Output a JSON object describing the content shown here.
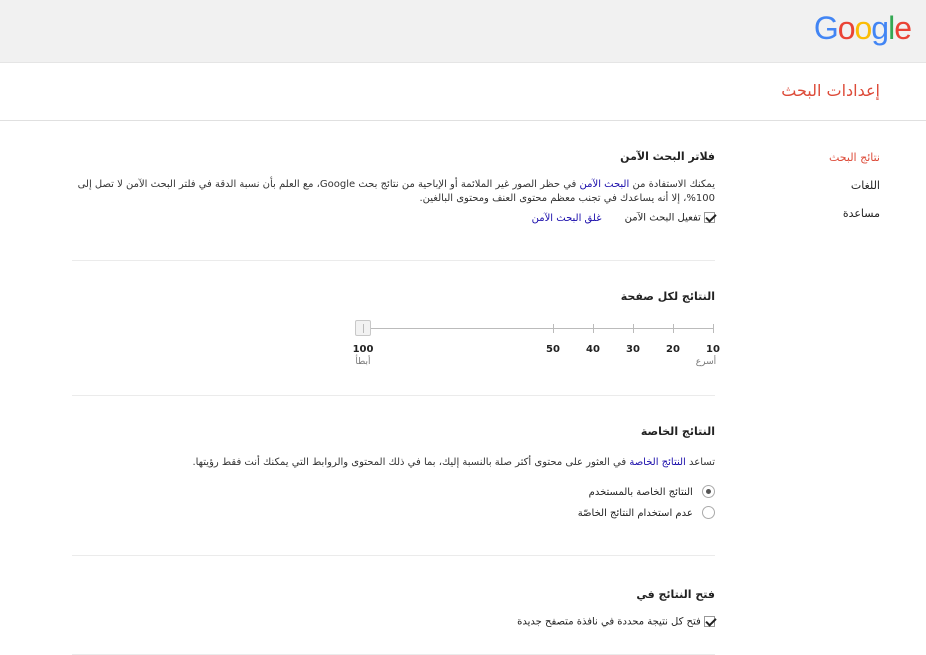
{
  "brand": {
    "logo_letters": [
      "G",
      "o",
      "o",
      "g",
      "l",
      "e"
    ],
    "logo_colors": [
      "#4285F4",
      "#EA4335",
      "#FBBC05",
      "#4285F4",
      "#34A853",
      "#EA4335"
    ]
  },
  "page": {
    "title": "إعدادات البحث"
  },
  "nav": {
    "items": [
      {
        "label": "نتائج البحث",
        "active": true
      },
      {
        "label": "اللغات",
        "active": false
      },
      {
        "label": "مساعدة",
        "active": false
      }
    ]
  },
  "safesearch": {
    "title": "فلاتر البحث الآمن",
    "desc_prefix": "يمكنك الاستفادة من",
    "desc_link": "البحث الآمن",
    "desc_rest": "في حظر الصور غير الملائمة أو الإباحية من نتائج بحث Google، مع العلم بأن نسبة الدقة في فلتر البحث الآمن لا تصل إلى 100%، إلا أنه يساعدك في تجنب معظم محتوى العنف ومحتوى البالغين.",
    "checkbox_label": "تفعيل البحث الآمن",
    "checked": true,
    "lock_link": "غلق البحث الآمن"
  },
  "results_per_page": {
    "title": "النتائج لكل صفحة",
    "ticks": [
      "10",
      "20",
      "30",
      "40",
      "50",
      "100"
    ],
    "tick_values": [
      10,
      20,
      30,
      40,
      50,
      100
    ],
    "selected": 100,
    "label_fast": "أسرع",
    "label_slow": "أبطأ"
  },
  "private": {
    "title": "النتائج الخاصة",
    "desc_prefix": "تساعد",
    "desc_link": "النتائج الخاصة",
    "desc_rest": "في العثور على محتوى أكثر صلة بالنسبة إليك، بما في ذلك المحتوى والروابط التي يمكنك أنت فقط رؤيتها.",
    "option_use": "النتائج الخاصة بالمستخدم",
    "option_no": "عدم استخدام النتائج الخاصّة",
    "selected": "use"
  },
  "open_results": {
    "title": "فتح النتائج في",
    "checkbox_label": "فتح كل نتيجة محددة في نافذة متصفح جديدة",
    "checked": true
  }
}
